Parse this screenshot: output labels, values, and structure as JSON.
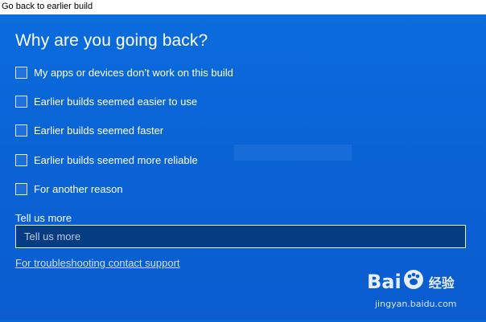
{
  "window": {
    "title": "Go back to earlier build"
  },
  "dialog": {
    "heading": "Why are you going back?",
    "options": [
      {
        "label": "My apps or devices don’t work on this build",
        "checked": false
      },
      {
        "label": "Earlier builds seemed easier to use",
        "checked": false
      },
      {
        "label": "Earlier builds seemed faster",
        "checked": false
      },
      {
        "label": "Earlier builds seemed more reliable",
        "checked": false
      },
      {
        "label": "For another reason",
        "checked": false
      }
    ],
    "tell_us": {
      "label": "Tell us more",
      "placeholder": "Tell us more",
      "value": ""
    },
    "support_link": "For troubleshooting contact support"
  },
  "watermark": {
    "brand_left": "Bai",
    "brand_right": "经验",
    "url": "jingyan.baidu.com",
    "paw_icon": "paw-icon"
  },
  "colors": {
    "background": "#0a64d6",
    "input_bg": "#063d82",
    "text": "#ffffff"
  }
}
